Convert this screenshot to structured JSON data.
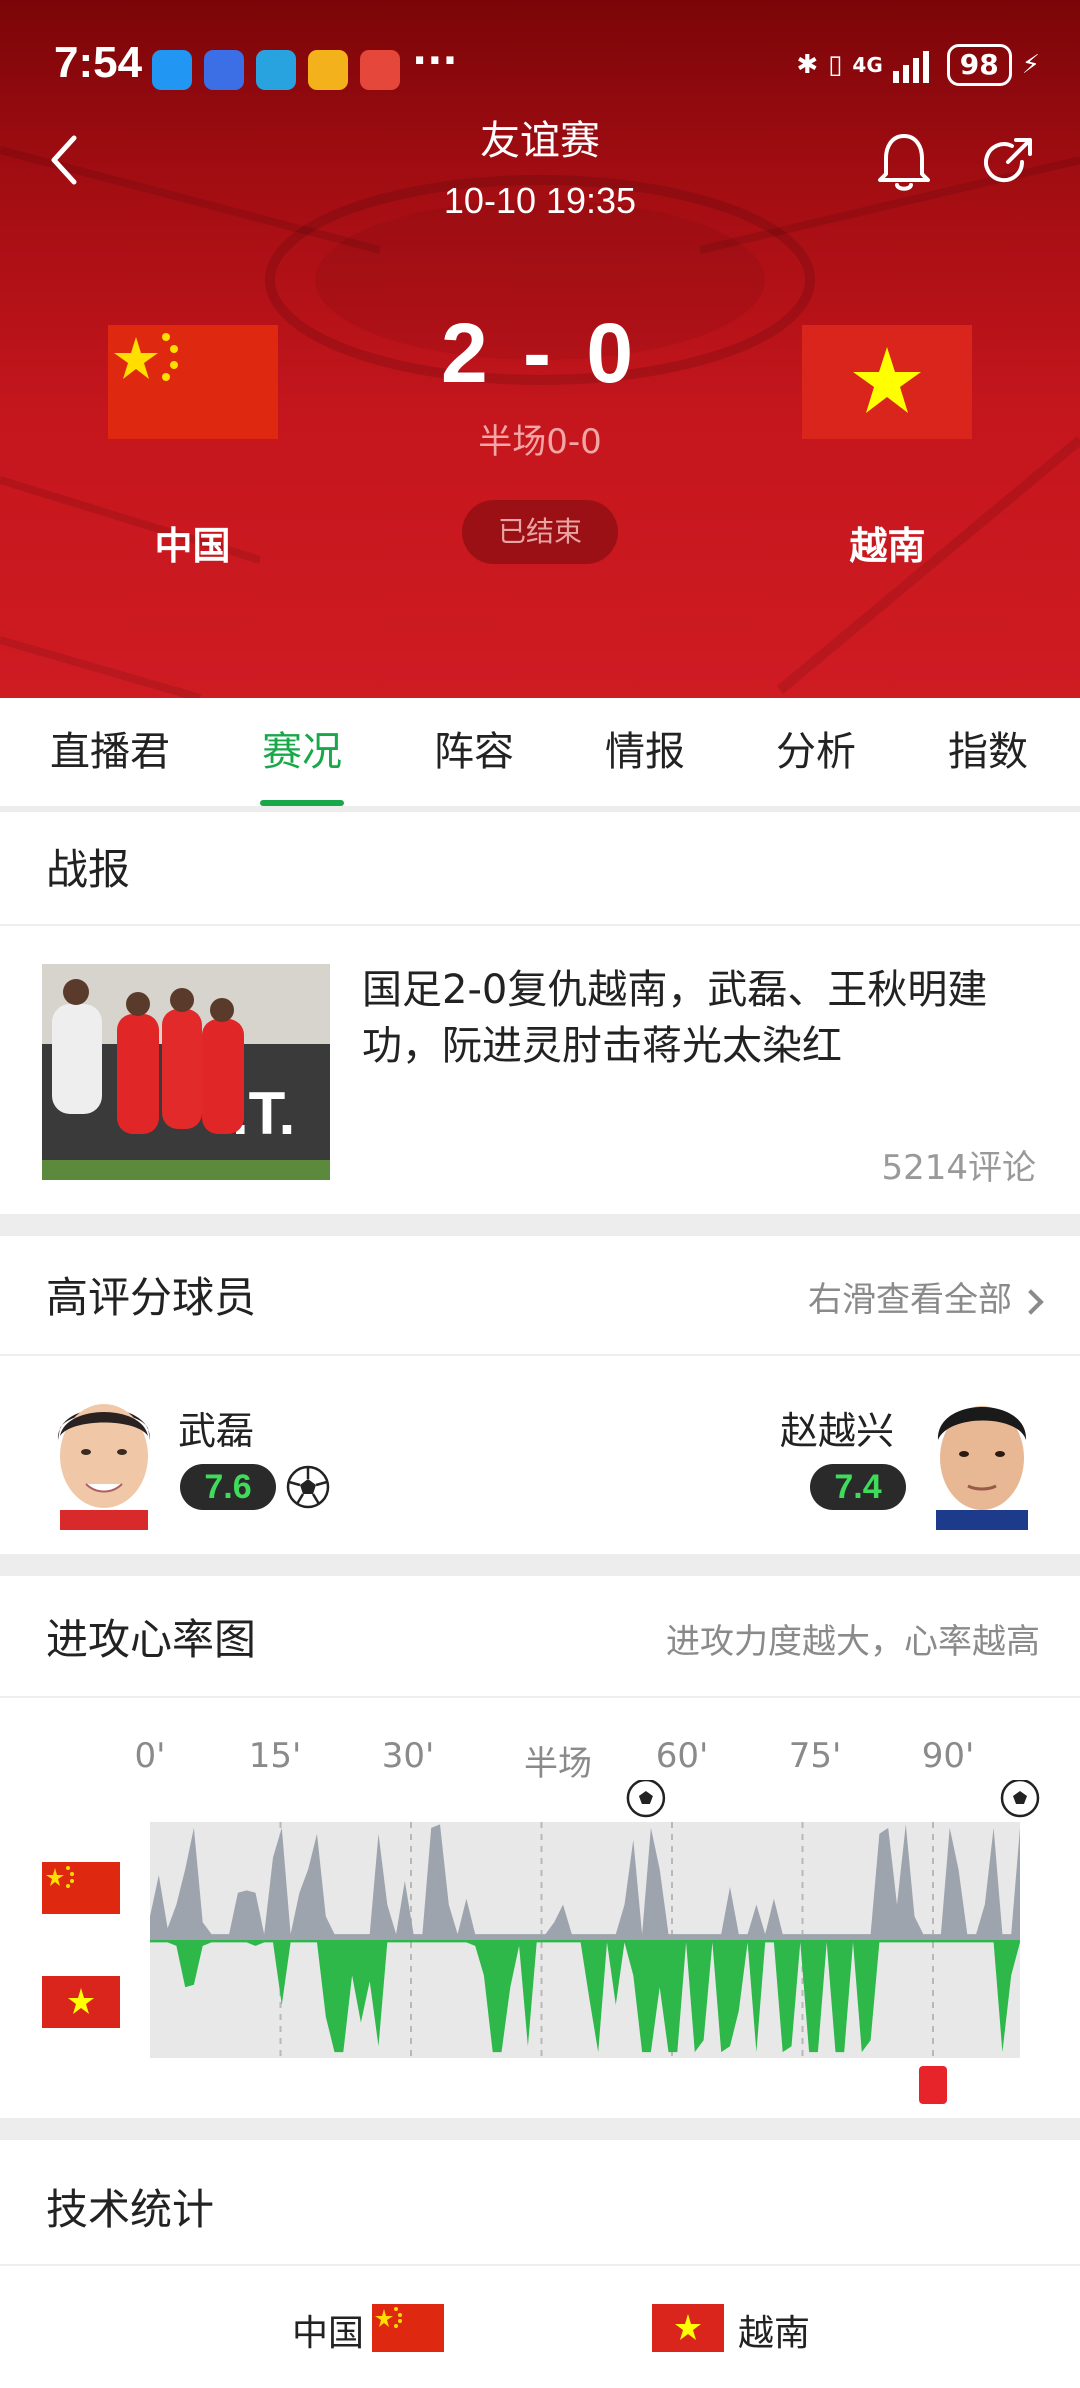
{
  "status_bar": {
    "time": "7:54",
    "more": "···",
    "signal": "4G",
    "battery": "98"
  },
  "header": {
    "title": "友谊赛",
    "datetime": "10-10 19:35",
    "home_team": "中国",
    "away_team": "越南",
    "score": "2 - 0",
    "halftime": "半场0-0",
    "status": "已结束"
  },
  "tabs": [
    "直播君",
    "赛况",
    "阵容",
    "情报",
    "分析",
    "指数"
  ],
  "active_tab": "赛况",
  "news": {
    "section_title": "战报",
    "headline": "国足2-0复仇越南，武磊、王秋明建功，阮进灵肘击蒋光太染红",
    "comments": "5214评论"
  },
  "top_players": {
    "section_title": "高评分球员",
    "hint": "右滑查看全部",
    "home": {
      "name": "武磊",
      "rating": "7.6"
    },
    "away": {
      "name": "赵越兴",
      "rating": "7.4"
    }
  },
  "attack_chart": {
    "section_title": "进攻心率图",
    "hint": "进攻力度越大，心率越高",
    "time_labels": [
      "0'",
      "15'",
      "30'",
      "半场",
      "60'",
      "75'",
      "90'"
    ]
  },
  "chart_data": {
    "type": "area",
    "x_labels": [
      "0'",
      "15'",
      "30'",
      "半场",
      "60'",
      "75'",
      "90'"
    ],
    "xlim": [
      0,
      100
    ],
    "home_attack_intensity": [
      0.2,
      0.55,
      0.1,
      0.3,
      0.6,
      0.95,
      0.15,
      0.05,
      0.05,
      0.05,
      0.4,
      0.42,
      0.4,
      0.05,
      0.7,
      0.95,
      0.05,
      0.4,
      0.6,
      0.9,
      0.2,
      0.05,
      0.05,
      0.05,
      0.05,
      0.05,
      0.9,
      0.3,
      0.05,
      0.5,
      0.05,
      0.05,
      0.95,
      0.98,
      0.3,
      0.05,
      0.35,
      0.05,
      0.05,
      0.05,
      0.05,
      0.05,
      0.05,
      0.05,
      0.05,
      0.05,
      0.15,
      0.3,
      0.05,
      0.05,
      0.05,
      0.05,
      0.05,
      0.05,
      0.3,
      0.85,
      0.05,
      0.95,
      0.6,
      0.05,
      0.05,
      0.05,
      0.05,
      0.05,
      0.05,
      0.05,
      0.45,
      0.05,
      0.05,
      0.3,
      0.05,
      0.35,
      0.05,
      0.05,
      0.05,
      0.05,
      0.05,
      0.05,
      0.05,
      0.05,
      0.05,
      0.05,
      0.05,
      0.9,
      0.95,
      0.3,
      0.98,
      0.2,
      0.05,
      0.05,
      0.05,
      0.95,
      0.6,
      0.05,
      0.05,
      0.3,
      0.95,
      0.05,
      0.05,
      0.95
    ],
    "away_attack_intensity": [
      0.02,
      0.02,
      0.02,
      0.05,
      0.4,
      0.38,
      0.05,
      0.02,
      0.02,
      0.02,
      0.02,
      0.02,
      0.05,
      0.02,
      0.02,
      0.55,
      0.02,
      0.02,
      0.02,
      0.02,
      0.65,
      0.95,
      0.95,
      0.3,
      0.7,
      0.35,
      0.9,
      0.02,
      0.02,
      0.02,
      0.02,
      0.02,
      0.02,
      0.02,
      0.02,
      0.02,
      0.02,
      0.05,
      0.3,
      0.95,
      0.95,
      0.4,
      0.05,
      0.9,
      0.02,
      0.02,
      0.02,
      0.02,
      0.02,
      0.02,
      0.5,
      0.95,
      0.02,
      0.55,
      0.02,
      0.3,
      0.95,
      0.95,
      0.4,
      0.95,
      0.95,
      0.02,
      0.95,
      0.85,
      0.02,
      0.95,
      0.9,
      0.6,
      0.02,
      0.95,
      0.02,
      0.02,
      0.95,
      0.9,
      0.02,
      0.95,
      0.95,
      0.02,
      0.95,
      0.95,
      0.02,
      0.95,
      0.85,
      0.02,
      0.02,
      0.02,
      0.02,
      0.02,
      0.02,
      0.02,
      0.02,
      0.02,
      0.02,
      0.02,
      0.02,
      0.02,
      0.02,
      0.95,
      0.3,
      0.02
    ],
    "events": [
      {
        "type": "goal",
        "minute": 57,
        "team": "home"
      },
      {
        "type": "goal",
        "minute": 100,
        "team": "home"
      },
      {
        "type": "red_card",
        "minute": 90,
        "team": "away"
      }
    ],
    "colors": {
      "home": "#9ea4ae",
      "away": "#2eb84a",
      "background": "#e8e8e8"
    }
  },
  "tech_stats": {
    "section_title": "技术统计",
    "home_team": "中国",
    "away_team": "越南"
  }
}
